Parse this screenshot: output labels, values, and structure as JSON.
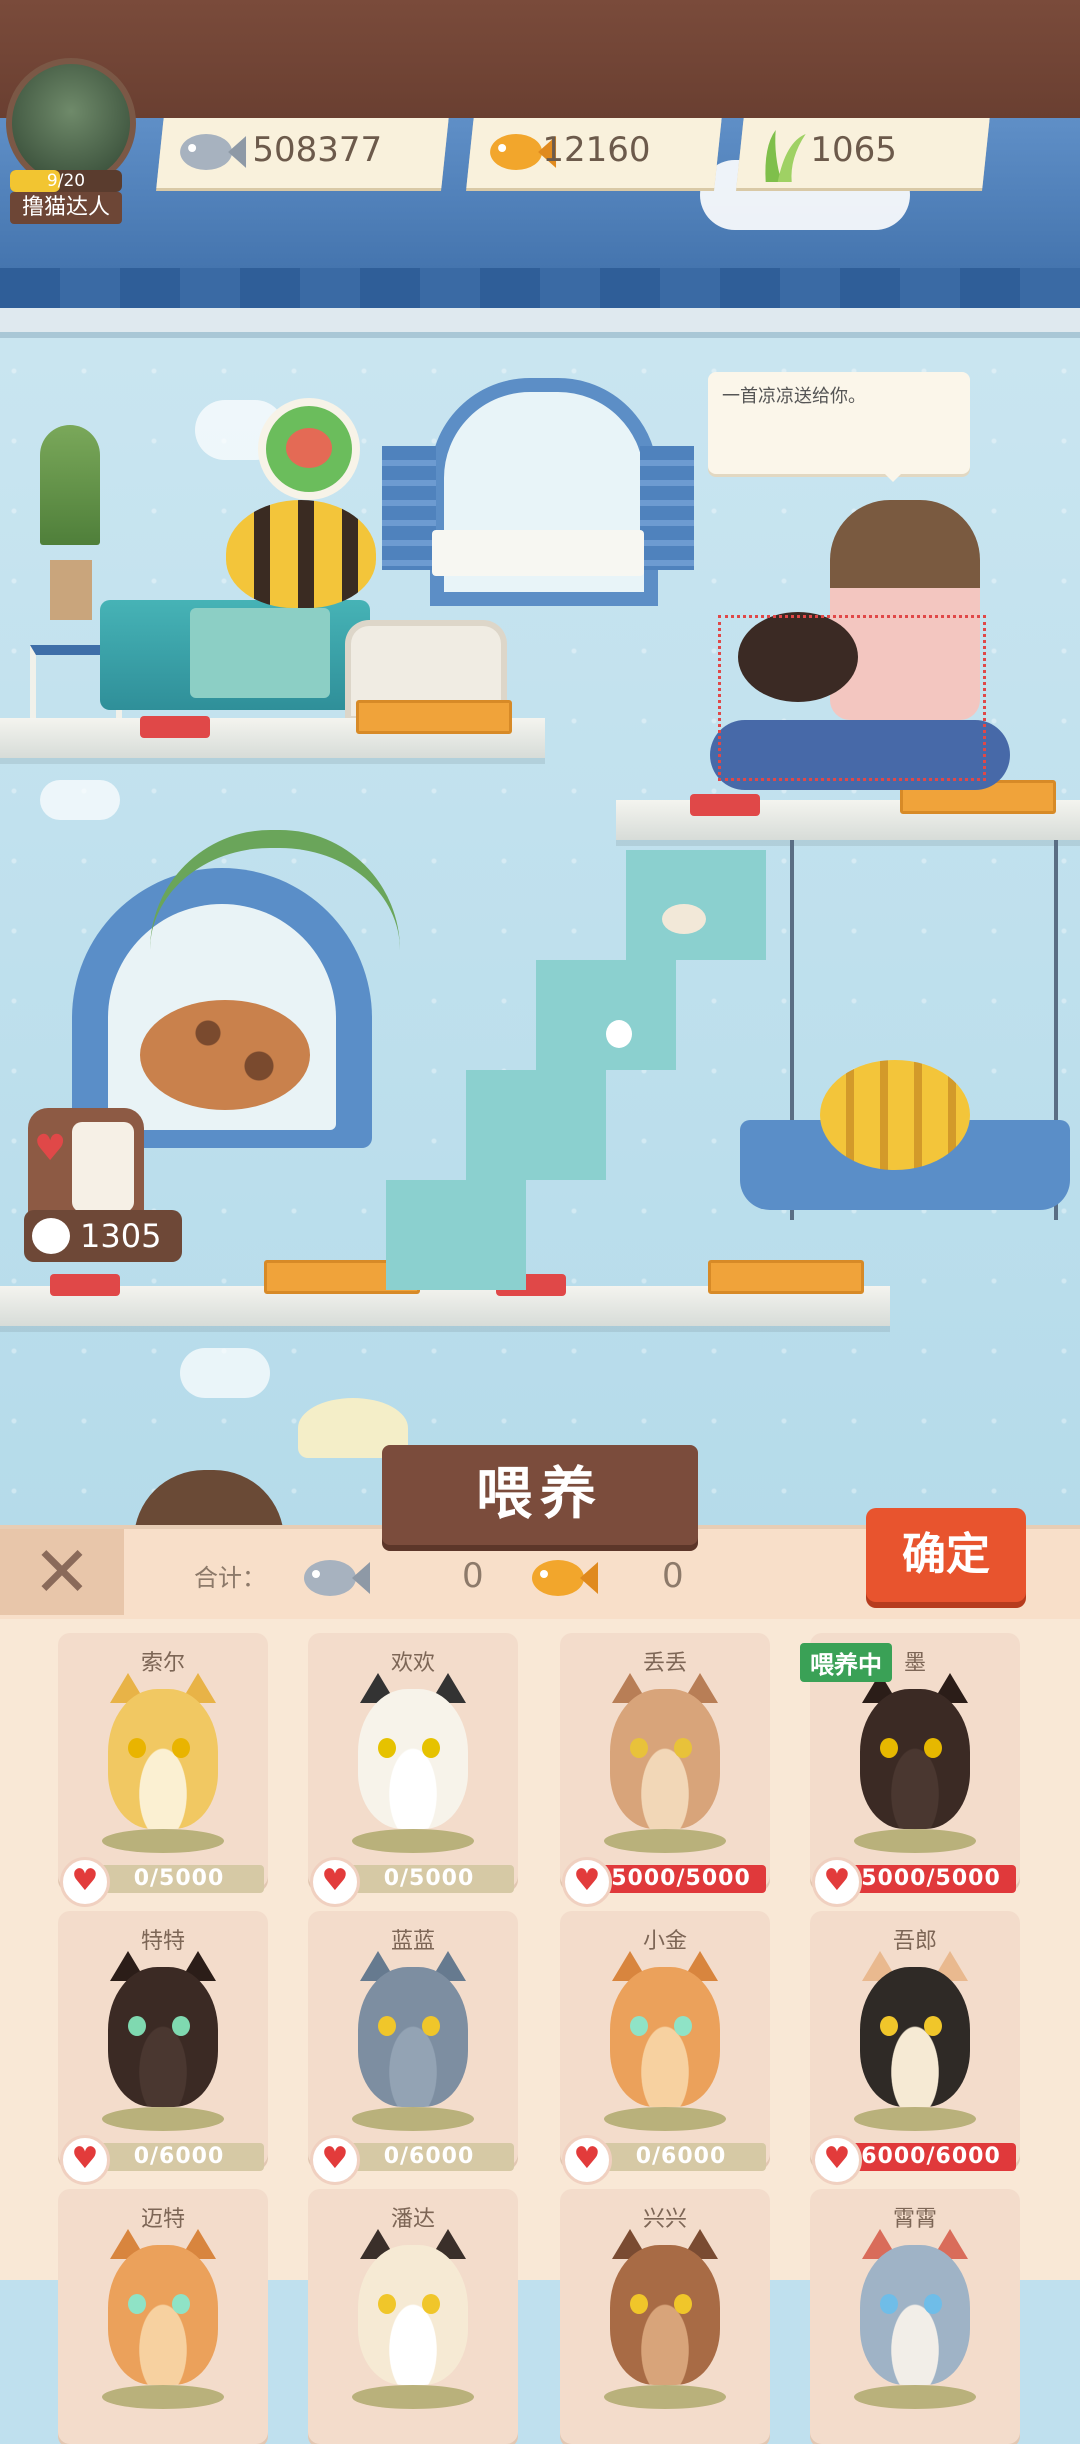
{
  "player": {
    "level_progress": "9/20",
    "level_fraction": 0.45,
    "title": "撸猫达人"
  },
  "resources": [
    {
      "icon": "silver-fish-icon",
      "value": "508377"
    },
    {
      "icon": "gold-fish-icon",
      "value": "12160"
    },
    {
      "icon": "grass-icon",
      "value": "1065"
    }
  ],
  "speech": "一首凉凉送给你。",
  "jar_count": "1305",
  "feed_panel": {
    "title": "喂养",
    "total_label": "合计：",
    "silver_total": "0",
    "gold_total": "0",
    "confirm_label": "确定",
    "close_glyph": "✕"
  },
  "colors": {
    "accent": "#e8542e",
    "panel": "#f9e8d6",
    "card": "#f3dccb",
    "hp_full": "#e0393b",
    "hp_empty": "#d6c9a5"
  },
  "cats": [
    {
      "name": "索尔",
      "hp": "0/5000",
      "full": false,
      "feeding": false,
      "body": "#f1c862",
      "belly": "#fbf0d2",
      "ear": "#e8b347",
      "eye": "#e9b400"
    },
    {
      "name": "欢欢",
      "hp": "0/5000",
      "full": false,
      "feeding": false,
      "body": "#f7f3ea",
      "belly": "#ffffff",
      "ear": "#333333",
      "eye": "#e6c200"
    },
    {
      "name": "丢丢",
      "hp": "5000/5000",
      "full": true,
      "feeding": false,
      "body": "#d8a47a",
      "belly": "#f2d7b7",
      "ear": "#b87e56",
      "eye": "#e8c23a"
    },
    {
      "name": "墨",
      "hp": "5000/5000",
      "full": true,
      "feeding": true,
      "feeding_label": "喂养中",
      "body": "#3b2a24",
      "belly": "#4a3730",
      "ear": "#2b1d18",
      "eye": "#e6b800"
    },
    {
      "name": "特特",
      "hp": "0/6000",
      "full": false,
      "feeding": false,
      "body": "#3b2a24",
      "belly": "#4a3730",
      "ear": "#2b1d18",
      "eye": "#7fd9b0"
    },
    {
      "name": "蓝蓝",
      "hp": "0/6000",
      "full": false,
      "feeding": false,
      "body": "#7d8ea1",
      "belly": "#93a3b4",
      "ear": "#667a8f",
      "eye": "#f0c62a"
    },
    {
      "name": "小金",
      "hp": "0/6000",
      "full": false,
      "feeding": false,
      "body": "#eba15b",
      "belly": "#f7d1a0",
      "ear": "#d8853e",
      "eye": "#8fe3c6"
    },
    {
      "name": "吾郎",
      "hp": "6000/6000",
      "full": true,
      "feeding": false,
      "body": "#2f2a26",
      "belly": "#f6ead4",
      "ear": "#e9b98f",
      "eye": "#f0c62a"
    },
    {
      "name": "迈特",
      "hp": "",
      "full": false,
      "feeding": false,
      "body": "#eba15b",
      "belly": "#f7d1a0",
      "ear": "#d8853e",
      "eye": "#8fe3c6"
    },
    {
      "name": "潘达",
      "hp": "",
      "full": false,
      "feeding": false,
      "body": "#f6ead4",
      "belly": "#ffffff",
      "ear": "#3a2f2a",
      "eye": "#f0c62a"
    },
    {
      "name": "兴兴",
      "hp": "",
      "full": false,
      "feeding": false,
      "body": "#a86b45",
      "belly": "#d8a47a",
      "ear": "#7a4b32",
      "eye": "#f0c62a"
    },
    {
      "name": "霄霄",
      "hp": "",
      "full": false,
      "feeding": false,
      "body": "#9fb3c6",
      "belly": "#f2eee8",
      "ear": "#d96c5a",
      "eye": "#6fbde8"
    }
  ]
}
